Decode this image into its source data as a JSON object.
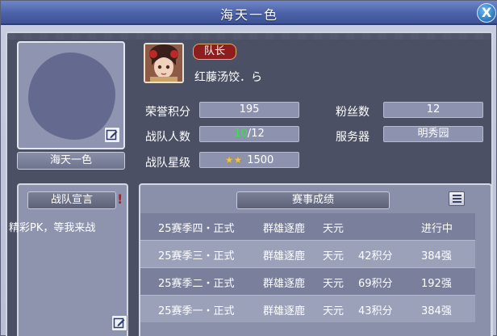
{
  "window": {
    "title": "海天一色",
    "close_label": "X"
  },
  "team": {
    "name": "海天一色",
    "leader": {
      "role": "队长",
      "name": "红藤汤饺．ら"
    },
    "stats": {
      "honor_label": "荣誉积分",
      "honor_value": "195",
      "fans_label": "粉丝数",
      "fans_value": "12",
      "members_label": "战队人数",
      "members_current": "10",
      "members_sep": "/",
      "members_max": "12",
      "server_label": "服务器",
      "server_value": "明秀园",
      "stars_label": "战队星级",
      "stars_count": 2,
      "stars_glyph": "★★",
      "stars_value": "1500"
    }
  },
  "declaration": {
    "header": "战队宣言",
    "alert": "!",
    "text": "精彩PK，等我来战"
  },
  "results": {
    "header": "赛事成绩",
    "rows": [
      {
        "season": "25赛季四・正式",
        "mode": "群雄逐鹿",
        "tier": "天元",
        "points": "",
        "result": "进行中"
      },
      {
        "season": "25赛季三・正式",
        "mode": "群雄逐鹿",
        "tier": "天元",
        "points": "42积分",
        "result": "384强"
      },
      {
        "season": "25赛季二・正式",
        "mode": "群雄逐鹿",
        "tier": "天元",
        "points": "69积分",
        "result": "192强"
      },
      {
        "season": "25赛季一・正式",
        "mode": "群雄逐鹿",
        "tier": "天元",
        "points": "43积分",
        "result": "384强"
      }
    ]
  },
  "icons": {
    "edit": "edit-icon",
    "menu": "menu-icon",
    "close": "close-icon",
    "star": "star-icon"
  }
}
